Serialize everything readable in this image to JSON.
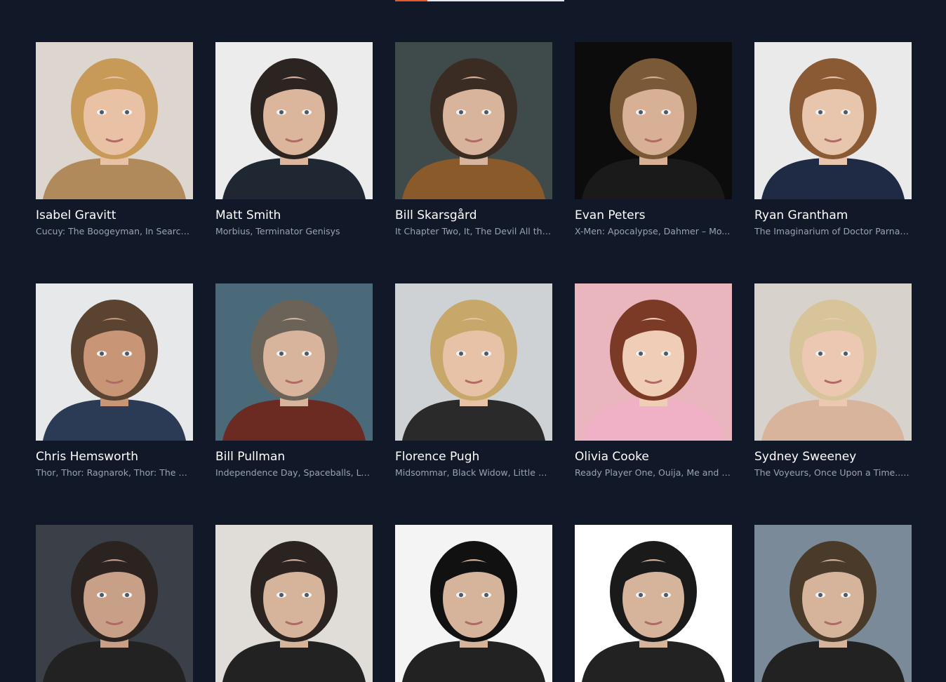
{
  "people": [
    {
      "name": "Isabel Gravitt",
      "credits": "Cucuy: The Boogeyman, In Search ...",
      "bg": "#dcd6cf",
      "hair": "#c89a58",
      "skin": "#e9c2a6",
      "cloth": "#b08a5a"
    },
    {
      "name": "Matt Smith",
      "credits": "Morbius, Terminator Genisys",
      "bg": "#ececec",
      "hair": "#2b2420",
      "skin": "#dcb69c",
      "cloth": "#1f2733"
    },
    {
      "name": "Bill Skarsgård",
      "credits": "It Chapter Two, It, The Devil All the...",
      "bg": "#3f4a4a",
      "hair": "#3a2c22",
      "skin": "#d9b49c",
      "cloth": "#8a5a2b"
    },
    {
      "name": "Evan Peters",
      "credits": "X-Men: Apocalypse, Dahmer – Mo...",
      "bg": "#0c0c0c",
      "hair": "#7a5a36",
      "skin": "#d8b096",
      "cloth": "#1a1a1a"
    },
    {
      "name": "Ryan Grantham",
      "credits": "The Imaginarium of Doctor Parnas...",
      "bg": "#eaeaea",
      "hair": "#8a5a34",
      "skin": "#e8c6ae",
      "cloth": "#1f2a44"
    },
    {
      "name": "Chris Hemsworth",
      "credits": "Thor, Thor: Ragnarok, Thor: The D...",
      "bg": "#e6e8ea",
      "hair": "#5a4330",
      "skin": "#c89676",
      "cloth": "#2b3a55"
    },
    {
      "name": "Bill Pullman",
      "credits": "Independence Day, Spaceballs, Lo...",
      "bg": "#4a6a7a",
      "hair": "#6b6258",
      "skin": "#d8b49c",
      "cloth": "#6b2a22"
    },
    {
      "name": "Florence Pugh",
      "credits": "Midsommar, Black Widow, Little W...",
      "bg": "#cfd2d4",
      "hair": "#c7a86a",
      "skin": "#e8c2a6",
      "cloth": "#2a2a2a"
    },
    {
      "name": "Olivia Cooke",
      "credits": "Ready Player One, Ouija, Me and E...",
      "bg": "#e8b6bc",
      "hair": "#7a3a26",
      "skin": "#efcdb6",
      "cloth": "#f0b0c6"
    },
    {
      "name": "Sydney Sweeney",
      "credits": "The Voyeurs, Once Upon a Time... ...",
      "bg": "#d8d2cc",
      "hair": "#d8c49a",
      "skin": "#ecc8b2",
      "cloth": "#d8b49c"
    },
    {
      "name": "",
      "credits": "",
      "bg": "#3a3f48",
      "hair": "#2a2320",
      "skin": "#c8a088",
      "cloth": "#222"
    },
    {
      "name": "",
      "credits": "",
      "bg": "#e0ddd8",
      "hair": "#2a2320",
      "skin": "#d6b49c",
      "cloth": "#222"
    },
    {
      "name": "",
      "credits": "",
      "bg": "#f4f4f4",
      "hair": "#111111",
      "skin": "#d6b49c",
      "cloth": "#222"
    },
    {
      "name": "",
      "credits": "",
      "bg": "#ffffff",
      "hair": "#1a1a1a",
      "skin": "#d6b49c",
      "cloth": "#222"
    },
    {
      "name": "",
      "credits": "",
      "bg": "#7a8a99",
      "hair": "#4a3a2a",
      "skin": "#d6b49c",
      "cloth": "#222"
    }
  ],
  "colors": {
    "page_bg": "#111827",
    "name_text": "#ffffff",
    "credits_text": "#9aa3b2",
    "tab_active": "#e05a2b"
  }
}
